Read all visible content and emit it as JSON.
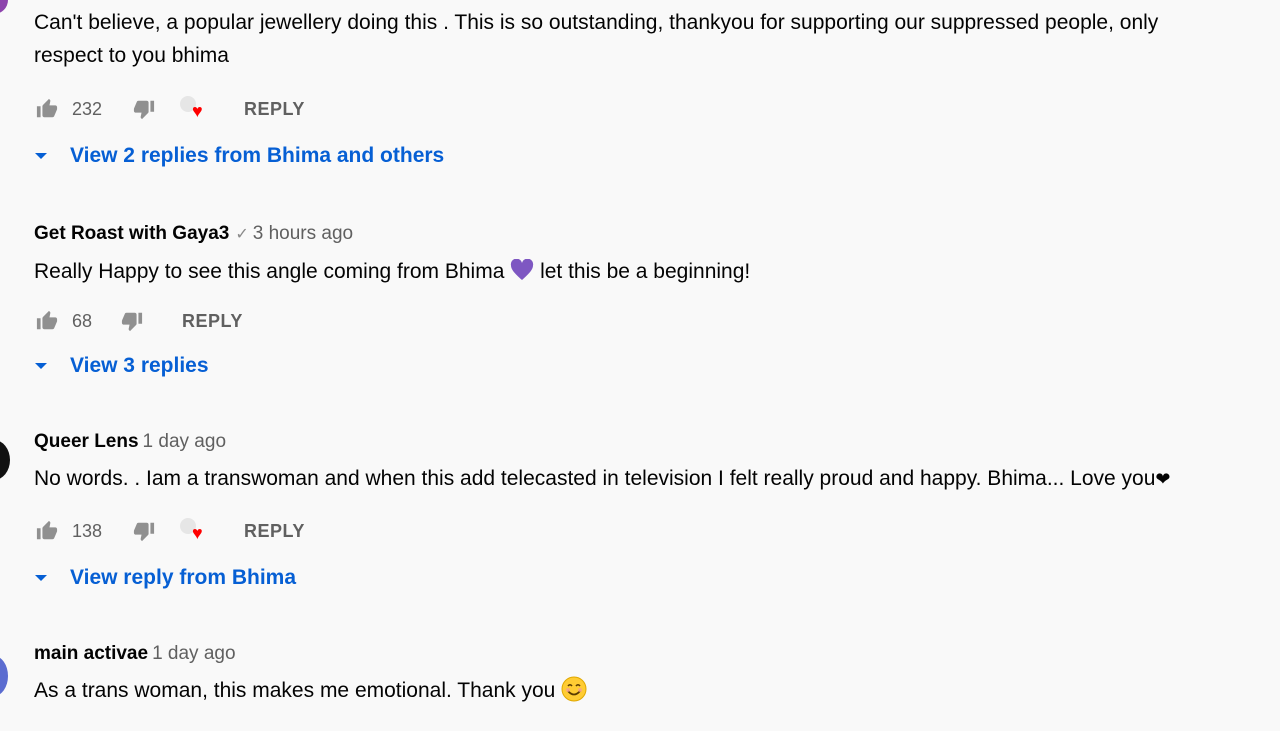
{
  "comments": [
    {
      "author": "",
      "time": "",
      "text": "Can't believe, a popular jewellery doing this . This is so outstanding, thankyou for supporting our suppressed people, only",
      "text2": "respect to you bhima",
      "likes": "232",
      "reply_label": "REPLY",
      "hearted": true,
      "view_replies": "View 2 replies from Bhima and others",
      "avatar_color": "#8e44ad"
    },
    {
      "author": "Get Roast with Gaya3",
      "time": "3 hours ago",
      "text": "Really Happy to see this angle coming from Bhima",
      "text_after_emoji": "let this be a beginning!",
      "likes": "68",
      "reply_label": "REPLY",
      "hearted": false,
      "view_replies": "View 3 replies",
      "verified": true
    },
    {
      "author": "Queer Lens",
      "time": "1 day ago",
      "text": "No words. . Iam a transwoman and when this add telecasted in television I felt really proud and happy. Bhima... Love you",
      "likes": "138",
      "reply_label": "REPLY",
      "hearted": true,
      "view_replies": "View reply from Bhima",
      "avatar_color": "#111111"
    },
    {
      "author": "main activae",
      "time": "1 day ago",
      "text": "As a trans woman, this makes me emotional. Thank you",
      "avatar_color": "#5b6cd0"
    }
  ],
  "icons": {
    "like": "thumb-up-icon",
    "dislike": "thumb-down-icon",
    "heart": "creator-heart-icon",
    "chevron": "chevron-down-icon",
    "purple_heart": "purple-heart-emoji",
    "black_heart": "black-heart-emoji",
    "smiling_face": "smiling-face-emoji"
  },
  "colors": {
    "link_blue": "#065fd4",
    "heart_red": "#ff0000",
    "meta_gray": "#606060"
  }
}
